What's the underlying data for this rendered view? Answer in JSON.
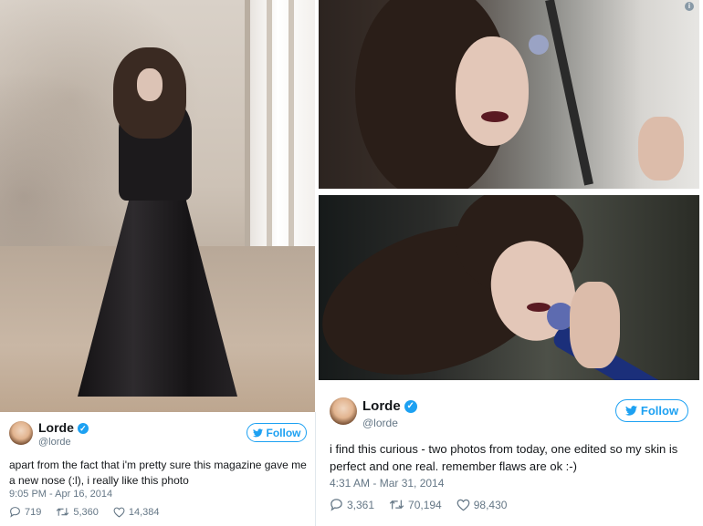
{
  "tweets": {
    "left": {
      "name": "Lorde",
      "handle": "@lorde",
      "follow_label": "Follow",
      "text": "apart from the fact that i'm pretty sure this magazine gave me a new nose (:l), i really like this photo",
      "timestamp": "9:05 PM - Apr 16, 2014",
      "replies": "719",
      "retweets": "5,360",
      "likes": "14,384"
    },
    "right": {
      "name": "Lorde",
      "handle": "@lorde",
      "follow_label": "Follow",
      "text": "i find this curious - two photos from today, one edited so my skin is perfect and one real. remember flaws are ok :-)",
      "timestamp": "4:31 AM - Mar 31, 2014",
      "replies": "3,361",
      "retweets": "70,194",
      "likes": "98,430"
    }
  },
  "icons": {
    "verified": "verified-badge-icon",
    "bird": "twitter-bird-icon",
    "reply": "reply-icon",
    "retweet": "retweet-icon",
    "like": "heart-icon",
    "info": "info-icon"
  },
  "colors": {
    "twitter_blue": "#1da1f2",
    "meta_gray": "#657786",
    "text": "#14171a"
  }
}
